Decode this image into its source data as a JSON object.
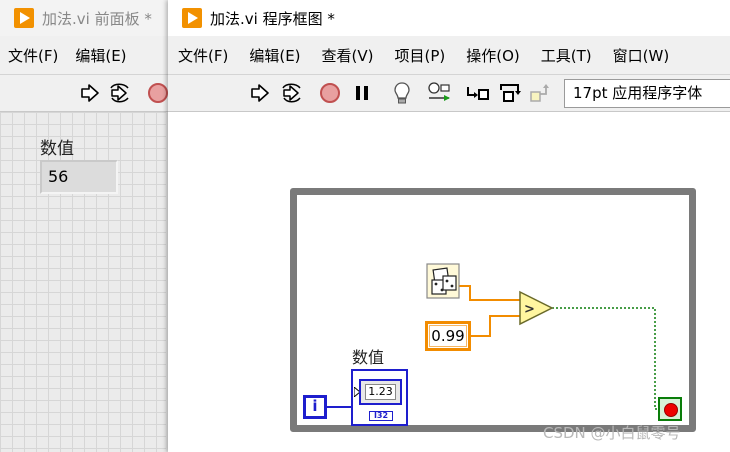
{
  "front_panel": {
    "title": "加法.vi 前面板 *",
    "menus": [
      "文件(F)",
      "编辑(E)"
    ],
    "control_label": "数值",
    "control_value": "56"
  },
  "block_diagram": {
    "title": "加法.vi 程序框图 *",
    "menus": [
      "文件(F)",
      "编辑(E)",
      "查看(V)",
      "项目(P)",
      "操作(O)",
      "工具(T)",
      "窗口(W)"
    ],
    "toolbar": {
      "font": "17pt 应用程序字体"
    },
    "numeric_constant": "0.99",
    "iteration_terminal": "i",
    "indicator_label": "数值",
    "indicator_display": "1.23",
    "indicator_type": "I32"
  },
  "watermark": "CSDN @小白鼠零号",
  "colors": {
    "labview_orange": "#f29100",
    "integer_blue": "#1e1ecd",
    "float_orange": "#f28c00",
    "boolean_green": "#0a7d0a",
    "loop_gray": "#7a7a7a"
  }
}
